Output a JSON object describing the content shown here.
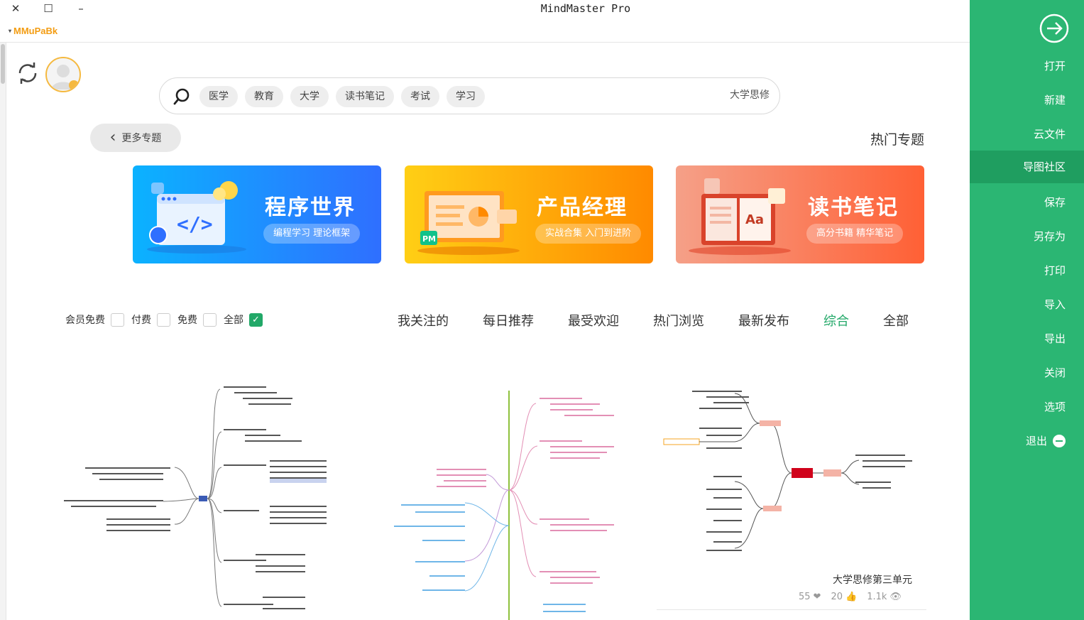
{
  "window": {
    "title": "MindMaster Pro",
    "close_glyph": "✕",
    "maximize_glyph": "☐",
    "minimize_glyph": "–",
    "account_name": "MMuPaBk",
    "account_caret": "▾"
  },
  "search": {
    "tags": [
      "医学",
      "教育",
      "大学",
      "读书笔记",
      "考试",
      "学习"
    ],
    "query": "大学思修"
  },
  "topics": {
    "heading": "热门专题",
    "more_label": "更多专题",
    "more_glyph": "‹",
    "banners": [
      {
        "title": "程序世界",
        "subtitle": "编程学习 理论框架",
        "colors": [
          "#0bb2ff",
          "#2f6fff"
        ]
      },
      {
        "title": "产品经理",
        "subtitle": "实战合集 入门到进阶",
        "colors": [
          "#ffcf15",
          "#ff8a00"
        ]
      },
      {
        "title": "读书笔记",
        "subtitle": "高分书籍 精华笔记",
        "colors": [
          "#f5a088",
          "#ff6035"
        ]
      }
    ]
  },
  "filter_tabs": [
    "我关注的",
    "每日推荐",
    "最受欢迎",
    "热门浏览",
    "最新发布",
    "综合",
    "全部"
  ],
  "active_tab": "综合",
  "price_filter": [
    {
      "label": "会员免费",
      "checked": false
    },
    {
      "label": "付费",
      "checked": false
    },
    {
      "label": "免费",
      "checked": false
    },
    {
      "label": "全部",
      "checked": true
    }
  ],
  "cards": [
    {
      "title": "",
      "views": "",
      "likes": "",
      "favorites": ""
    },
    {
      "title": "",
      "views": "",
      "likes": "",
      "favorites": ""
    },
    {
      "title": "大学思修第三单元",
      "views": "1.1k",
      "likes": "20",
      "favorites": "55"
    }
  ],
  "sidebar": {
    "items": [
      "打开",
      "新建",
      "云文件",
      "导图社区",
      "保存",
      "另存为",
      "打印",
      "导入",
      "导出",
      "关闭",
      "选项"
    ],
    "active": "导图社区",
    "exit_label": "退出"
  },
  "colors": {
    "accent": "#2bb673",
    "accent_dark": "#1f9e60",
    "active_tab": "#22a868",
    "account": "#f39c12"
  }
}
